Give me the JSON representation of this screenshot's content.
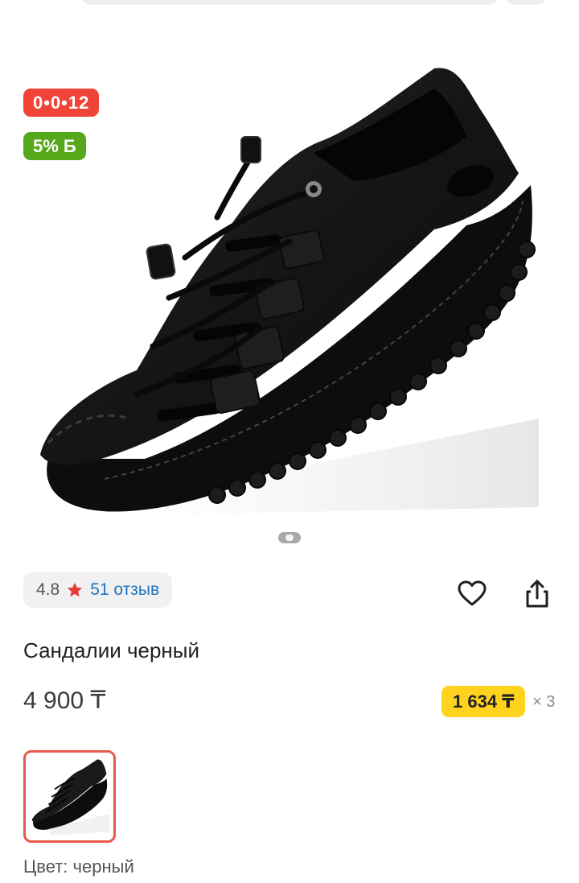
{
  "badges": {
    "timer": "0•0•12",
    "bonus": "5% Б"
  },
  "rating": {
    "value": "4.8",
    "reviews": "51 отзыв"
  },
  "product": {
    "title": "Сандалии черный",
    "price": "4 900 ₸",
    "installment": {
      "amount": "1 634 ₸",
      "multiplier": "× 3"
    }
  },
  "variant": {
    "label_prefix": "Цвет:",
    "color": "черный"
  },
  "icons": {
    "star": "star-icon",
    "favorite": "heart-icon",
    "share": "share-icon"
  },
  "colors": {
    "timer_badge": "#f04438",
    "bonus_badge": "#56a719",
    "installment_badge": "#ffd21e",
    "reviews_link": "#1e73be",
    "star": "#e53935",
    "thumb_border": "#e8584b"
  }
}
